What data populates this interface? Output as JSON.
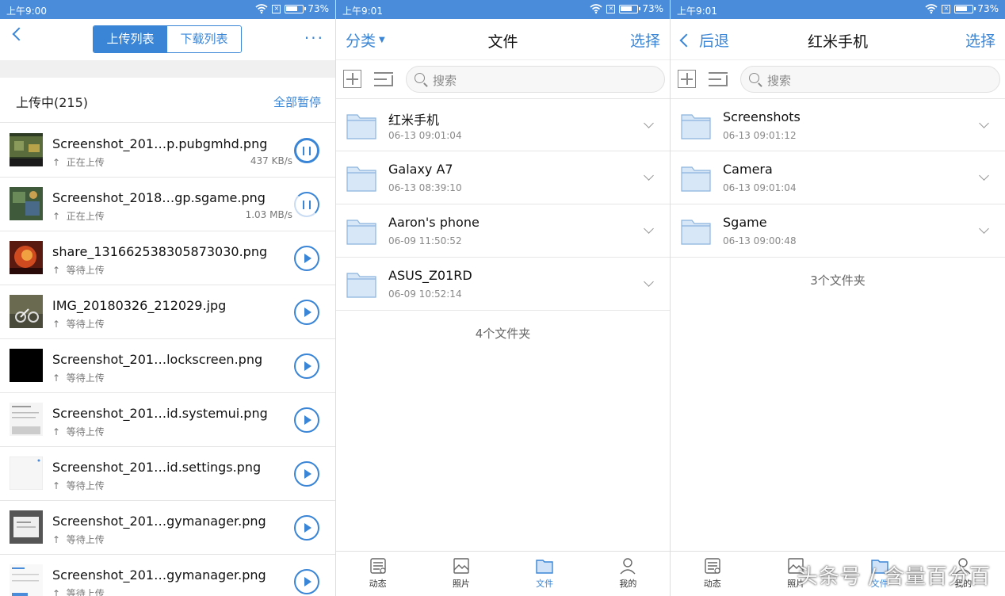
{
  "status_bars": [
    {
      "time": "上午9:00",
      "battery": "73%"
    },
    {
      "time": "上午9:01",
      "battery": "73%"
    },
    {
      "time": "上午9:01",
      "battery": "73%"
    }
  ],
  "upload_panel": {
    "tab_upload": "上传列表",
    "tab_download": "下载列表",
    "section_label": "上传中(215)",
    "pause_all": "全部暂停",
    "items": [
      {
        "name": "Screenshot_201…p.pubgmhd.png",
        "status": "正在上传",
        "speed": "437 KB/s"
      },
      {
        "name": "Screenshot_2018…gp.sgame.png",
        "status": "正在上传",
        "speed": "1.03 MB/s"
      },
      {
        "name": "share_131662538305873030.png",
        "status": "等待上传",
        "speed": ""
      },
      {
        "name": "IMG_20180326_212029.jpg",
        "status": "等待上传",
        "speed": ""
      },
      {
        "name": "Screenshot_201…lockscreen.png",
        "status": "等待上传",
        "speed": ""
      },
      {
        "name": "Screenshot_201…id.systemui.png",
        "status": "等待上传",
        "speed": ""
      },
      {
        "name": "Screenshot_201…id.settings.png",
        "status": "等待上传",
        "speed": ""
      },
      {
        "name": "Screenshot_201…gymanager.png",
        "status": "等待上传",
        "speed": ""
      },
      {
        "name": "Screenshot_201…gymanager.png",
        "status": "等待上传",
        "speed": ""
      }
    ]
  },
  "files_panel": {
    "left": "分类",
    "title": "文件",
    "right": "选择",
    "search_placeholder": "搜索",
    "folders": [
      {
        "name": "红米手机",
        "date": "06-13 09:01:04"
      },
      {
        "name": "Galaxy A7",
        "date": "06-13 08:39:10"
      },
      {
        "name": "Aaron's phone",
        "date": "06-09 11:50:52"
      },
      {
        "name": "ASUS_Z01RD",
        "date": "06-09 10:52:14"
      }
    ],
    "count": "4个文件夹"
  },
  "redmi_panel": {
    "left": "后退",
    "title": "红米手机",
    "right": "选择",
    "search_placeholder": "搜索",
    "folders": [
      {
        "name": "Screenshots",
        "date": "06-13 09:01:12"
      },
      {
        "name": "Camera",
        "date": "06-13 09:01:04"
      },
      {
        "name": "Sgame",
        "date": "06-13 09:00:48"
      }
    ],
    "count": "3个文件夹"
  },
  "tabs": [
    "动态",
    "照片",
    "文件",
    "我的"
  ],
  "watermark": "头条号 / 含量百分百",
  "colors": {
    "accent": "#3a85d6",
    "statusbar": "#4a8cd9"
  }
}
